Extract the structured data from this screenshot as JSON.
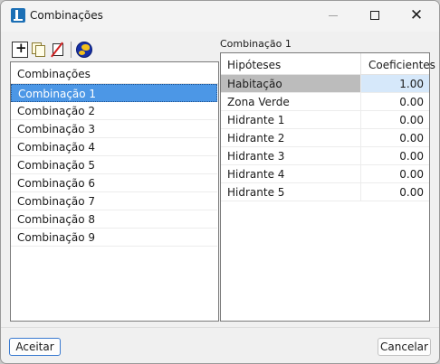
{
  "window": {
    "title": "Combinações",
    "close_glyph": "✕"
  },
  "toolbar": {
    "icons": [
      "add-icon",
      "copy-icon",
      "delete-icon",
      "globe-icon"
    ]
  },
  "list": {
    "header": "Combinações",
    "items": [
      {
        "label": "Combinação 1",
        "selected": true
      },
      {
        "label": "Combinação 2",
        "selected": false
      },
      {
        "label": "Combinação 3",
        "selected": false
      },
      {
        "label": "Combinação 4",
        "selected": false
      },
      {
        "label": "Combinação 5",
        "selected": false
      },
      {
        "label": "Combinação 6",
        "selected": false
      },
      {
        "label": "Combinação 7",
        "selected": false
      },
      {
        "label": "Combinação 8",
        "selected": false
      },
      {
        "label": "Combinação 9",
        "selected": false
      }
    ]
  },
  "table": {
    "label": "Combinação 1",
    "headers": {
      "hypothesis": "Hipóteses",
      "coefficient": "Coeficientes"
    },
    "rows": [
      {
        "hypothesis": "Habitação",
        "coefficient": "1.00"
      },
      {
        "hypothesis": "Zona Verde",
        "coefficient": "0.00"
      },
      {
        "hypothesis": "Hidrante 1",
        "coefficient": "0.00"
      },
      {
        "hypothesis": "Hidrante 2",
        "coefficient": "0.00"
      },
      {
        "hypothesis": "Hidrante 3",
        "coefficient": "0.00"
      },
      {
        "hypothesis": "Hidrante 4",
        "coefficient": "0.00"
      },
      {
        "hypothesis": "Hidrante 5",
        "coefficient": "0.00"
      }
    ]
  },
  "buttons": {
    "accept": "Aceitar",
    "cancel": "Cancelar"
  }
}
